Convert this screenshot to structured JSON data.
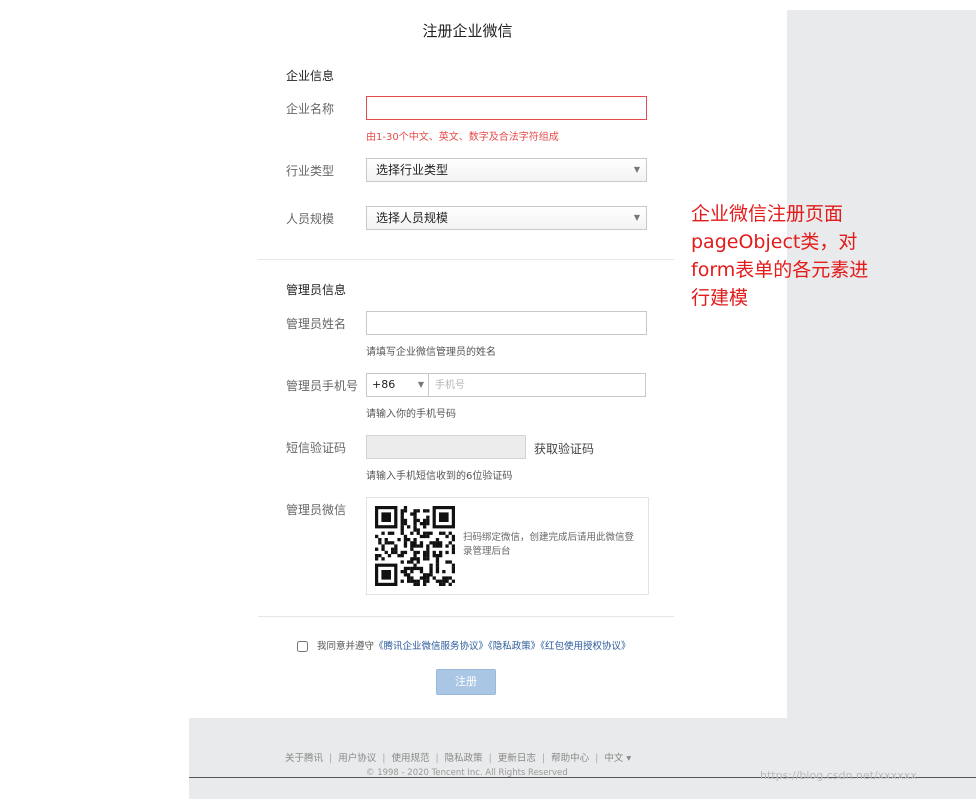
{
  "title": "注册企业微信",
  "company_section": {
    "title": "企业信息",
    "name_label": "企业名称",
    "name_value": "",
    "name_error": "由1-30个中文、英文、数字及合法字符组成",
    "industry_label": "行业类型",
    "industry_value": "选择行业类型",
    "size_label": "人员规模",
    "size_value": "选择人员规模"
  },
  "admin_section": {
    "title": "管理员信息",
    "name_label": "管理员姓名",
    "name_value": "",
    "name_hint": "请填写企业微信管理员的姓名",
    "phone_label": "管理员手机号",
    "country_code": "+86",
    "phone_placeholder": "手机号",
    "phone_hint": "请输入你的手机号码",
    "sms_label": "短信验证码",
    "sms_button": "获取验证码",
    "sms_hint": "请输入手机短信收到的6位验证码",
    "wechat_label": "管理员微信",
    "qr_text": "扫码绑定微信，创建完成后请用此微信登录管理后台"
  },
  "agreement": {
    "prefix": "我同意并遵守",
    "link1": "《腾讯企业微信服务协议》",
    "link2": "《隐私政策》",
    "link3": "《红包使用授权协议》",
    "checked": false
  },
  "submit_label": "注册",
  "annotation": "企业微信注册页面pageObject类，对form表单的各元素进行建模",
  "footer": {
    "links": [
      "关于腾讯",
      "用户协议",
      "使用规范",
      "隐私政策",
      "更新日志",
      "帮助中心"
    ],
    "language": "中文 ▾",
    "copyright": "© 1998 - 2020 Tencent Inc. All Rights Reserved"
  },
  "watermark": "https://blog.csdn.net/xxxxxx",
  "colors": {
    "error": "#e64b4b",
    "link": "#2a5a9a",
    "button_disabled": "#a9c6e5",
    "annotation": "#e21b1b",
    "grey_bg": "#e9eaeb"
  }
}
